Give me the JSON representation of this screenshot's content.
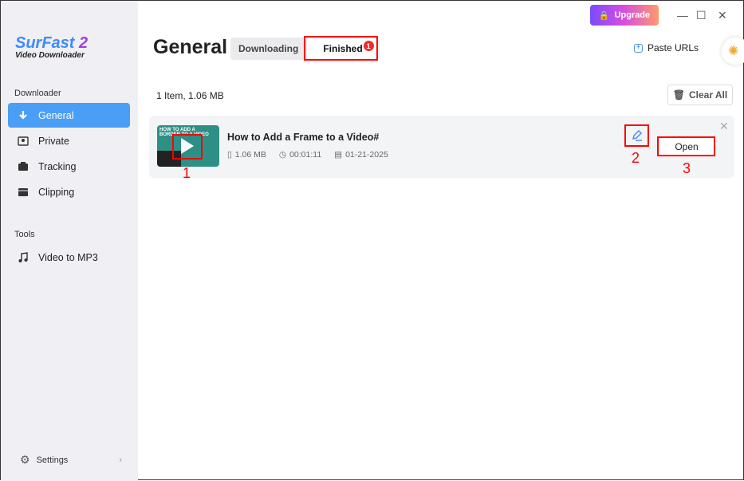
{
  "app": {
    "logo_main": "SurFast",
    "logo_num": "2",
    "logo_sub": "Video Downloader",
    "upgrade": "Upgrade"
  },
  "sidebar": {
    "section1": "Downloader",
    "items": [
      {
        "label": "General",
        "icon": "download-icon",
        "active": true
      },
      {
        "label": "Private",
        "icon": "private-icon"
      },
      {
        "label": "Tracking",
        "icon": "tracking-icon"
      },
      {
        "label": "Clipping",
        "icon": "clipping-icon"
      }
    ],
    "section2": "Tools",
    "tools": [
      {
        "label": "Video to MP3",
        "icon": "music-icon"
      }
    ],
    "settings": "Settings"
  },
  "header": {
    "title": "General",
    "tabs": [
      {
        "label": "Downloading"
      },
      {
        "label": "Finished",
        "badge": "1",
        "selected": true
      }
    ],
    "paste": "Paste URLs"
  },
  "list": {
    "summary": "1 Item, 1.06 MB",
    "clear_all": "Clear All",
    "items": [
      {
        "title": "How to Add a Frame to a Video#",
        "size": "1.06 MB",
        "duration": "00:01:11",
        "date": "01-21-2025",
        "thumb_text": "HOW TO ADD A BORDER TO A VIDEO",
        "open": "Open"
      }
    ]
  },
  "annotations": [
    "1",
    "2",
    "3"
  ],
  "colors": {
    "accent": "#4b9ef5",
    "annotation": "#ff0000",
    "badge": "#ee2b2b"
  }
}
